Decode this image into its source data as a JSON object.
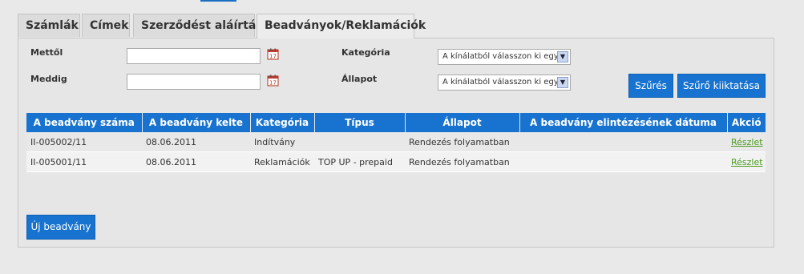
{
  "tabs": [
    {
      "label": "Számlák"
    },
    {
      "label": "Címek"
    },
    {
      "label": "Szerződést aláírták"
    },
    {
      "label": "Beadványok/Reklamációk"
    }
  ],
  "filters": {
    "from_label": "Mettől",
    "from_value": "",
    "to_label": "Meddig",
    "to_value": "",
    "category_label": "Kategória",
    "category_selected": "A kínálatból válasszon ki egyet",
    "status_label": "Állapot",
    "status_selected": "A kínálatból válasszon ki egyet",
    "filter_button": "Szűrés",
    "clear_button": "Szűrő kiiktatása"
  },
  "table": {
    "headers": [
      "A beadvány száma",
      "A beadvány kelte",
      "Kategória",
      "Típus",
      "Állapot",
      "A beadvány elintézésének dátuma",
      "Akció"
    ],
    "rows": [
      [
        "II-005002/11",
        "08.06.2011",
        "Indítvány",
        "",
        "Rendezés folyamatban",
        "",
        "Részlet"
      ],
      [
        "II-005001/11",
        "08.06.2011",
        "Reklamációk",
        "TOP UP - prepaid",
        "Rendezés folyamatban",
        "",
        "Részlet"
      ]
    ]
  },
  "new_button": "Új beadvány",
  "colors": {
    "accent": "#1773cf",
    "link": "#4a9b1f"
  }
}
